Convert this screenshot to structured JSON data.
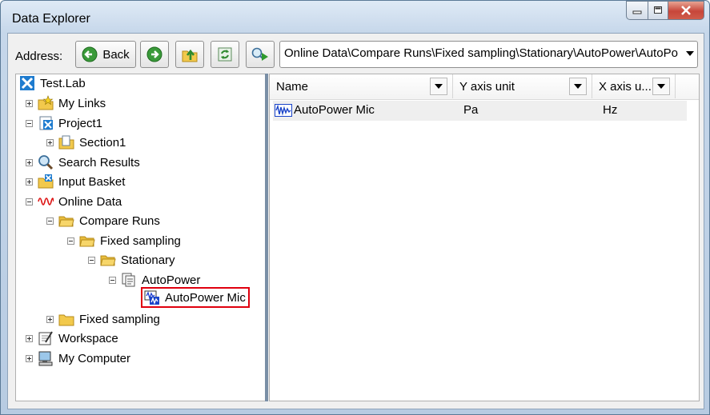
{
  "window": {
    "title": "Data Explorer"
  },
  "toolbar": {
    "address_label": "Address:",
    "back_label": "Back",
    "address_path": "Online Data\\Compare Runs\\Fixed sampling\\Stationary\\AutoPower\\AutoPow"
  },
  "tree": {
    "root": "Test.Lab",
    "my_links": "My Links",
    "project1": "Project1",
    "section1": "Section1",
    "search_results": "Search Results",
    "input_basket": "Input Basket",
    "online_data": "Online Data",
    "compare_runs": "Compare Runs",
    "fixed_sampling": "Fixed sampling",
    "stationary": "Stationary",
    "autopower": "AutoPower",
    "autopower_mic": "AutoPower Mic",
    "fixed_sampling_2": "Fixed sampling",
    "workspace": "Workspace",
    "my_computer": "My Computer"
  },
  "list": {
    "columns": [
      "Name",
      "Y axis unit",
      "X axis u..."
    ],
    "rows": [
      {
        "name": "AutoPower Mic",
        "y_unit": "Pa",
        "x_unit": "Hz"
      }
    ]
  },
  "colors": {
    "selection_border": "#e0000e",
    "splitter": "#7a8fa6"
  }
}
